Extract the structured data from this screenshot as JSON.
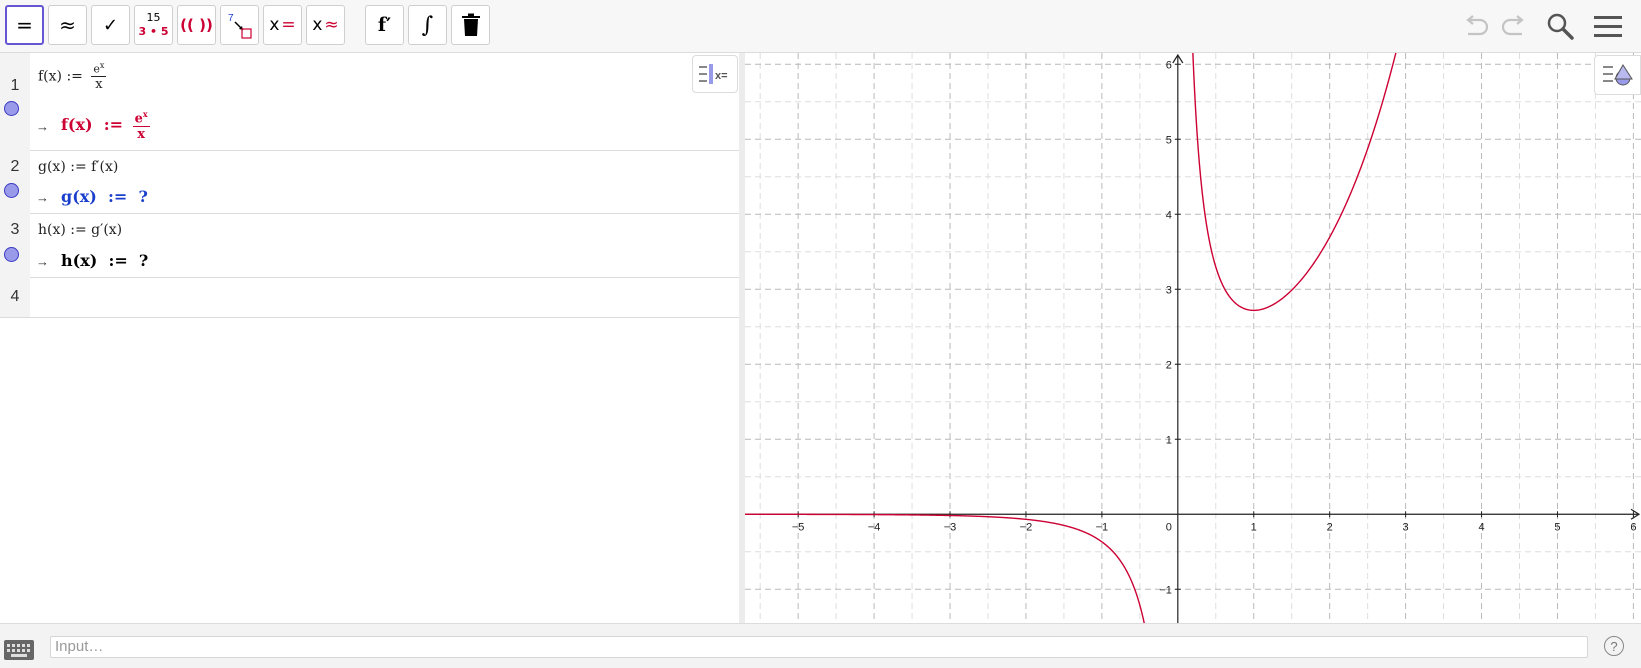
{
  "toolbar": {
    "eval_label": "=",
    "numeric_label": "≈",
    "keep_input_label": "✓",
    "factor_top": "15",
    "factor_bottom": "3 • 5",
    "expand_label": "(( ))",
    "substitute_label": "7",
    "solve_label_x": "x",
    "solve_label_eq": "=",
    "nsolve_label_x": "x",
    "nsolve_label_eq": "≈",
    "derivative_label": "f′",
    "integral_label": "∫"
  },
  "cas_rows": [
    {
      "number": "1",
      "input_prefix": "f(x) := ",
      "input_num": "e",
      "input_num_sup": "x",
      "input_den": "x",
      "arrow": "→",
      "output_prefix": "f(x)  :=",
      "output_num": "e",
      "output_num_sup": "x",
      "output_den": "x",
      "color": "#cc0033"
    },
    {
      "number": "2",
      "input": "g(x) := f′(x)",
      "arrow": "→",
      "output": "g(x)  :=  ?",
      "color": "#1a3fcc"
    },
    {
      "number": "3",
      "input": "h(x) := g′(x)",
      "arrow": "→",
      "output": "h(x)  :=  ?",
      "color": "#000000"
    },
    {
      "number": "4"
    }
  ],
  "input_bar": {
    "placeholder": "Input…",
    "help_label": "?"
  },
  "graph": {
    "x_ticks": [
      "−5",
      "−4",
      "−3",
      "−2",
      "−1",
      "0",
      "1",
      "2",
      "3",
      "4",
      "5",
      "6"
    ],
    "y_ticks": [
      "6",
      "5",
      "4",
      "3",
      "2",
      "1",
      "−1"
    ],
    "curve_color": "#cc0033"
  },
  "chart_data": {
    "type": "line",
    "series": [
      {
        "function": "e^x / x"
      }
    ],
    "xlim": [
      -5.7,
      6.1
    ],
    "ylim": [
      -1.45,
      6.15
    ],
    "grid": true
  }
}
